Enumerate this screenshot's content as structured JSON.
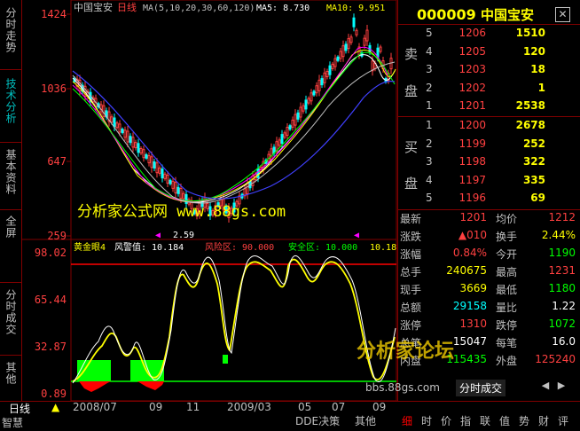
{
  "left_tabs": [
    "分时走势",
    "技术分析",
    "基本资料",
    "全屏",
    "分时成交",
    "其他"
  ],
  "active_left_tab": "技术分析",
  "chart": {
    "name": "中国宝安",
    "period": "日线",
    "ma_label": "MA(5,10,20,30,60,120)",
    "ma5_label": "MA5: 8.730",
    "ma10_label": "MA10: 9.951",
    "price_axis": [
      "1424",
      "1036",
      "647",
      "259"
    ],
    "low_marker": "2.59",
    "indicator_name": "黄金眼4",
    "indicator_alert": "风警值: 10.184",
    "indicator_risk": "风险区: 90.000",
    "indicator_safe": "安全区: 10.000",
    "indicator_extra": "10.18",
    "indicator_axis": [
      "98.02",
      "65.44",
      "32.87",
      "0.89"
    ],
    "watermark": "分析家公式网 www.88gs.com"
  },
  "quote": {
    "code": "000009",
    "name": "中国宝安",
    "sell_label": [
      "卖",
      "盘"
    ],
    "buy_label": [
      "买",
      "盘"
    ],
    "sell": [
      {
        "level": "5",
        "price": "1206",
        "vol": "1510"
      },
      {
        "level": "4",
        "price": "1205",
        "vol": "120"
      },
      {
        "level": "3",
        "price": "1203",
        "vol": "18"
      },
      {
        "level": "2",
        "price": "1202",
        "vol": "1"
      },
      {
        "level": "1",
        "price": "1201",
        "vol": "2538"
      }
    ],
    "buy": [
      {
        "level": "1",
        "price": "1200",
        "vol": "2678"
      },
      {
        "level": "2",
        "price": "1199",
        "vol": "252"
      },
      {
        "level": "3",
        "price": "1198",
        "vol": "322"
      },
      {
        "level": "4",
        "price": "1197",
        "vol": "335"
      },
      {
        "level": "5",
        "price": "1196",
        "vol": "69"
      }
    ],
    "stats": [
      {
        "l1": "最新",
        "v1": "1201",
        "c1": "#ff4040",
        "l2": "均价",
        "v2": "1212",
        "c2": "#ff4040"
      },
      {
        "l1": "涨跌",
        "v1": "▲010",
        "c1": "#ff4040",
        "l2": "换手",
        "v2": "2.44%",
        "c2": "#ffff00"
      },
      {
        "l1": "涨幅",
        "v1": "0.84%",
        "c1": "#ff4040",
        "l2": "今开",
        "v2": "1190",
        "c2": "#00ff00"
      },
      {
        "l1": "总手",
        "v1": "240675",
        "c1": "#ffff00",
        "l2": "最高",
        "v2": "1231",
        "c2": "#ff4040"
      },
      {
        "l1": "现手",
        "v1": "3669",
        "c1": "#ffff00",
        "l2": "最低",
        "v2": "1180",
        "c2": "#00ff00"
      },
      {
        "l1": "总额",
        "v1": "29158",
        "c1": "#00ffff",
        "l2": "量比",
        "v2": "1.22",
        "c2": "#ffffff"
      },
      {
        "l1": "涨停",
        "v1": "1310",
        "c1": "#ff4040",
        "l2": "跌停",
        "v2": "1072",
        "c2": "#00ff00"
      },
      {
        "l1": "总笔",
        "v1": "15047",
        "c1": "#ffffff",
        "l2": "每笔",
        "v2": "16.0",
        "c2": "#ffffff"
      },
      {
        "l1": "内盘",
        "v1": "115435",
        "c1": "#00ff00",
        "l2": "外盘",
        "v2": "125240",
        "c2": "#ff4040"
      }
    ],
    "subtab": "分时成交",
    "watermark_site": "bbs.88gs.com",
    "watermark_logo": "分析家论坛"
  },
  "bottom": {
    "period": "日线",
    "brand": "智慧",
    "dates": [
      "2008/07",
      "09",
      "11",
      "2009/03",
      "05",
      "07",
      "09"
    ],
    "tabs": [
      "DDE决策",
      "其他"
    ],
    "right_tabs": [
      "细",
      "时",
      "价",
      "指",
      "联",
      "值",
      "势",
      "财",
      "评"
    ]
  },
  "colors": {
    "up": "#ff4040",
    "down": "#00ffff",
    "border": "#800000",
    "accent": "#ffff00"
  }
}
